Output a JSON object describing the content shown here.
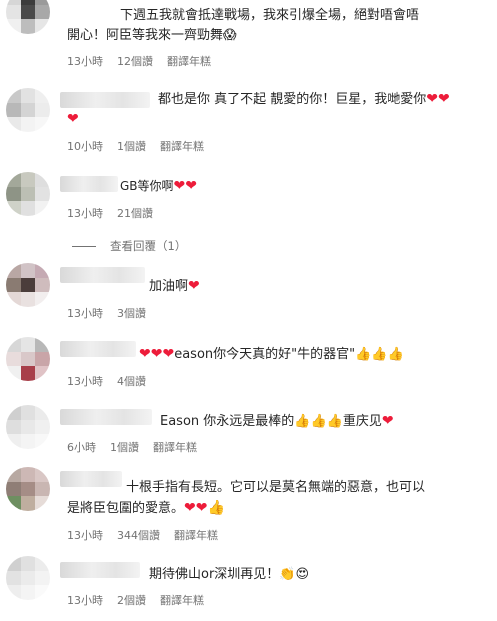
{
  "comments": [
    {
      "lines": [
        "下週五我就會抵達戰場，我來引爆全場，絕對唔會唔",
        "開心！阿臣等我來一齊勁舞"
      ],
      "emoji": "😱",
      "time": "13小時",
      "likes": "12個讚",
      "translate": "翻譯年糕"
    },
    {
      "lines": [
        "都也是你 真了不起 靚愛的你！巨星，我哋愛你",
        ""
      ],
      "emoji": "❤❤",
      "emoji2": "❤",
      "time": "10小時",
      "likes": "1個讚",
      "translate": "翻譯年糕"
    },
    {
      "lines": [
        "GB等你啊"
      ],
      "emoji": "❤❤",
      "time": "13小時",
      "likes": "21個讚"
    },
    {
      "lines": [
        "加油啊"
      ],
      "emoji": "❤",
      "time": "13小時",
      "likes": "3個讚"
    },
    {
      "prefix": "❤❤❤",
      "lines": [
        "eason你今天真的好\"牛的器官\""
      ],
      "emoji": "👍👍👍",
      "time": "13小時",
      "likes": "4個讚"
    },
    {
      "lines": [
        "Eason 你永远是最棒的"
      ],
      "emoji": "👍👍👍",
      "suffix": "重庆见",
      "heart": "❤",
      "time": "6小時",
      "likes": "1個讚",
      "translate": "翻譯年糕"
    },
    {
      "lines": [
        "十根手指有長短。它可以是莫名無端的惡意，也可以",
        "是將臣包圍的愛意。"
      ],
      "emoji": "❤❤👍",
      "time": "13小時",
      "likes": "344個讚",
      "translate": "翻譯年糕"
    },
    {
      "lines": [
        "期待佛山or深圳再见！"
      ],
      "emoji": "👏😍",
      "time": "13小時",
      "likes": "2個讚",
      "translate": "翻譯年糕"
    }
  ],
  "view_replies": "查看回覆（1）",
  "colors": {
    "heart": "#ed1c3a",
    "meta": "#737373",
    "text": "#262626"
  }
}
